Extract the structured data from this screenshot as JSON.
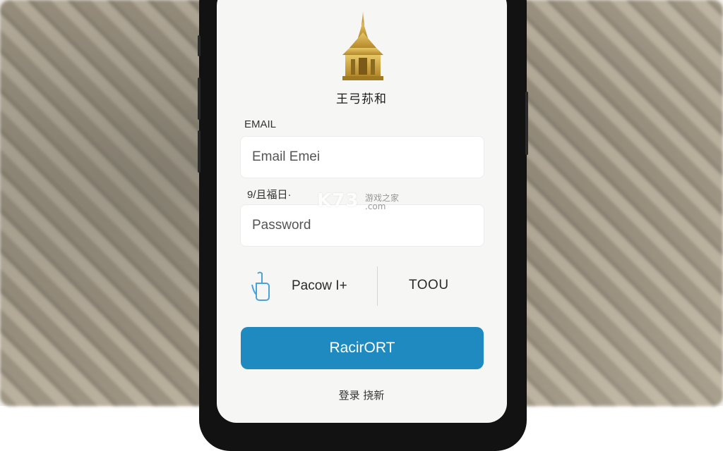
{
  "app": {
    "title": "王弓荪和"
  },
  "form": {
    "email_label": "EMAIL",
    "email_value": "Email Emei",
    "password_label": "9/且福日·",
    "password_placeholder": "Password"
  },
  "options": {
    "left_label": "Pacow  I+",
    "right_label": "TOOU"
  },
  "actions": {
    "primary_label": "RacirORT",
    "footer_link": "登录 挠新"
  },
  "watermark": {
    "brand": "K73",
    "site_cn": "游戏之家",
    "site_domain": ".com"
  },
  "colors": {
    "primary_button": "#1f8ac0",
    "screen_bg": "#f6f6f5",
    "logo_gold": "#c9a23a"
  },
  "icons": {
    "logo": "temple-pagoda-logo",
    "option_left": "touch-hand-icon"
  }
}
